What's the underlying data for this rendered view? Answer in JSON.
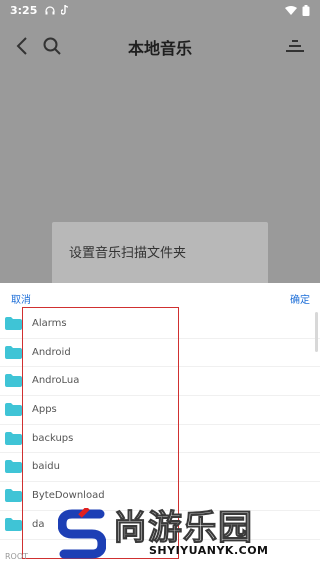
{
  "status_bar": {
    "time": "3:25",
    "icons": [
      "headphones-icon",
      "tiktok-icon"
    ],
    "right_icons": [
      "wifi-icon",
      "battery-icon"
    ]
  },
  "app_bar": {
    "title": "本地音乐",
    "back_icon": "back-icon",
    "search_icon": "search-icon",
    "menu_icon": "menu-icon"
  },
  "background_dialog": {
    "title": "设置音乐扫描文件夹"
  },
  "folder_picker": {
    "cancel_label": "取消",
    "confirm_label": "确定",
    "folders": [
      {
        "name": "Alarms"
      },
      {
        "name": "Android"
      },
      {
        "name": "AndroLua"
      },
      {
        "name": "Apps"
      },
      {
        "name": "backups"
      },
      {
        "name": "baidu"
      },
      {
        "name": "ByteDownload"
      },
      {
        "name": "da"
      }
    ],
    "footer_label": "ROOT"
  },
  "watermark": {
    "cn": "尚游乐园",
    "en": "SHYIYUANYK.COM"
  },
  "colors": {
    "accent": "#1e6fd8",
    "folder": "#3fc4d6",
    "highlight_box": "#d03030"
  }
}
